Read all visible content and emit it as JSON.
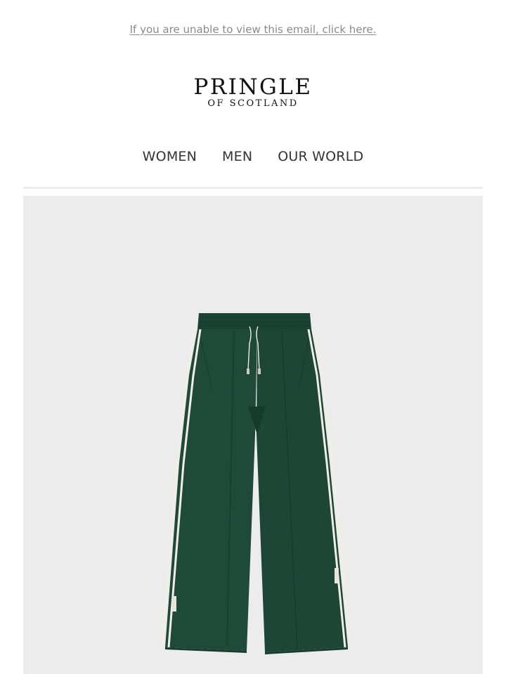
{
  "header": {
    "view_online_text": "If you are unable to view this email, click here."
  },
  "logo": {
    "brand": "PRINGLE",
    "subtitle": "OF SCOTLAND"
  },
  "nav": {
    "items": [
      {
        "label": "WOMEN"
      },
      {
        "label": "MEN"
      },
      {
        "label": "OUR WORLD"
      }
    ]
  },
  "hero": {
    "background_color": "#ececec",
    "product_color": "#1f4a3a",
    "stripe_color": "#f2eee6",
    "product_icon": "track-pants-image"
  }
}
